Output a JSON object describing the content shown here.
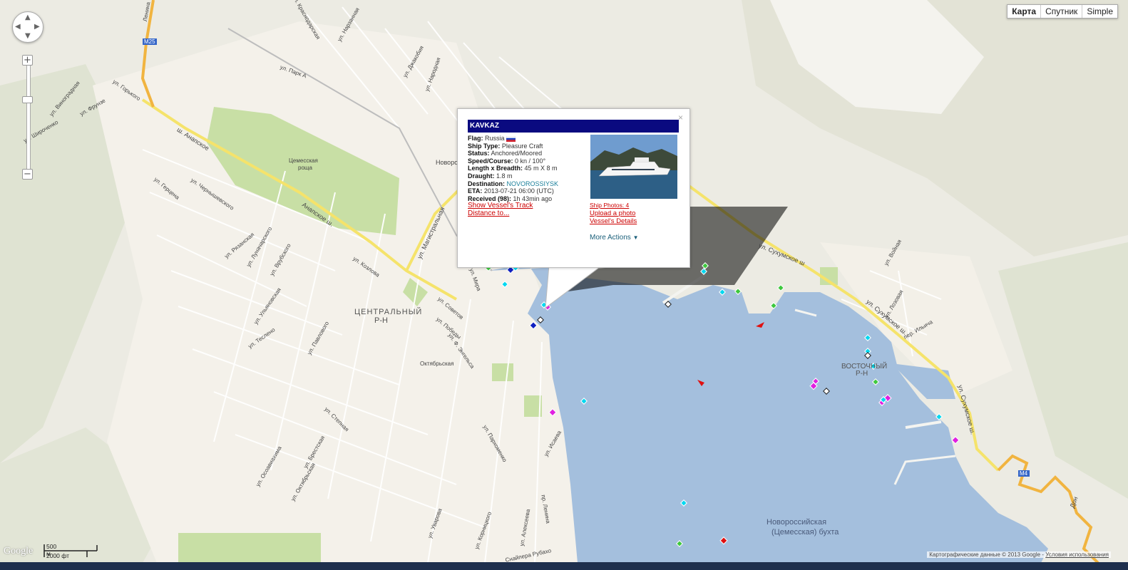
{
  "map_type_controls": [
    {
      "label": "Карта",
      "active": true
    },
    {
      "label": "Спутник",
      "active": false
    },
    {
      "label": "Simple",
      "active": false
    }
  ],
  "zoom": {
    "plus": "+",
    "minus": "−"
  },
  "popup": {
    "close": "×",
    "vessel_name": "KAVKAZ",
    "flag_label": "Flag:",
    "flag_value": "Russia",
    "type_label": "Ship Type:",
    "type_value": "Pleasure Craft",
    "status_label": "Status:",
    "status_value": "Anchored/Moored",
    "speed_label": "Speed/Course:",
    "speed_value": "0 kn / 100°",
    "size_label": "Length x Breadth:",
    "size_value": "45 m X 8 m",
    "draught_label": "Draught:",
    "draught_value": "1.8 m",
    "dest_label": "Destination:",
    "dest_value": "NOVOROSSIYSK",
    "eta_label": "ETA:",
    "eta_value": "2013-07-21 06:00 (UTC)",
    "received_label": "Received (98):",
    "received_value": "1h 43min ago",
    "show_track": "Show Vessel's Track",
    "distance": "Distance to...",
    "ship_photos": "Ship Photos: 4",
    "upload_photo": "Upload a photo",
    "vessel_details": "Vessel's Details",
    "more_actions": "More Actions"
  },
  "map_labels": {
    "district_center_1": "ЦЕНТРАЛЬНЫЙ",
    "district_center_2": "Р-Н",
    "district_east_1": "ВОСТОЧНЫЙ",
    "district_east_2": "Р-Н",
    "bay_1": "Новороссийская",
    "bay_2": "(Цемесская) бухта",
    "grove_1": "Цемесская",
    "grove_2": "роща",
    "oktyabrskaya": "Октябрьская",
    "novoros": "Новорос",
    "m25": "M25",
    "m4": "M4",
    "anapskoe": "ш. Анапское",
    "anapskoe2": "Анапское ш.",
    "magistralnaya": "ул. Магистральная",
    "sukhumskoe": "ул. Сухумское ш",
    "sukhumskoe2": "ул. Сухумское ш.",
    "sukhumskoe3": "ул. Сухумское ш.",
    "lenina": "Ленина",
    "gorkogo": "ул. Горького",
    "kozlova": "ул. Козлова",
    "sovetov": "ул. Советов",
    "pobedy": "ул. Победы",
    "engelsa": "ул. Ф. Энгельса",
    "isaeva": "ул. Исаева",
    "mira": "ул. Мира",
    "gertsena": "ул. Герцена",
    "ryazanskaya": "ул. Рязанская",
    "vrubskogo": "ул. Врубского",
    "stepnaya": "ул. Степная",
    "brestskaya": "ул. Брестская",
    "oktyabrskaya_st": "ул. Октябрьская",
    "uvarova": "ул. Уварова",
    "kornitskogo": "ул. Корницкого",
    "alekseeva": "ул. Алексеева",
    "snaipera": "Снайпера Рубахо",
    "prosp_lenina": "пр. Ленина",
    "parkhomenko": "ул. Пархоменко",
    "lozovaya": "ул. Лозовая",
    "voinaya": "ул. Войная",
    "ilyicha": "пер. Ильича",
    "dzhakobia": "ул. Джакобия",
    "narodnaya": "ул. Народная",
    "narzannaya": "ул. Нарзанная",
    "krasnodarskaya": "ул. Краснодарская",
    "fruze": "ул. Фрунзе",
    "vinogradnaya": "ул. Виноградная",
    "shirochenko": "ул. Широченко",
    "chernyshevskogo": "ул. Чернышевского",
    "lunacharskogo": "ул. Луначарского",
    "ulyanovskaya": "ул. Ульяновская",
    "tesleno": "ул. Теслено",
    "pavlogo": "ул. Павлового",
    "osovy": "ул. Осоавиахима",
    "don": "Дон",
    "park": "ул. Парк А"
  },
  "scale": {
    "metric": "500 м",
    "imperial": "2000 фт"
  },
  "google_logo": "Google",
  "credits": {
    "data": "Картографические данные © 2013 Google -",
    "terms": "Условия использования"
  },
  "colors": {
    "water": "#a4bfdd",
    "land": "#f2efe9",
    "greenery": "#c8dfa5",
    "popup_title_bg": "#0a0a80",
    "link_red": "#cc0000",
    "marker_cyan": "#00d8f0",
    "marker_magenta": "#e020e0",
    "marker_green": "#3ec83e",
    "marker_red": "#e01010"
  }
}
